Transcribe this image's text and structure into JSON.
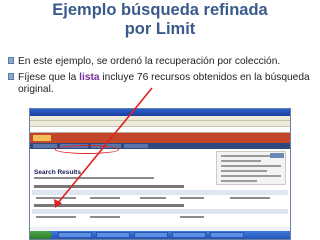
{
  "slide": {
    "title_line1": "Ejemplo búsqueda refinada",
    "title_line2": "por Limit",
    "bullet1": "En este ejemplo, se ordenó la recuperación por colección.",
    "bullet2_prefix": "Fíjese que la ",
    "bullet2_highlight": "lista",
    "bullet2_suffix": " incluye 76 recursos obtenidos en la búsqueda original."
  },
  "screenshot": {
    "results_heading": "Search Results"
  },
  "colors": {
    "title": "#3a5a8c",
    "highlight": "#7a2fa0",
    "annotation": "#e02020"
  }
}
